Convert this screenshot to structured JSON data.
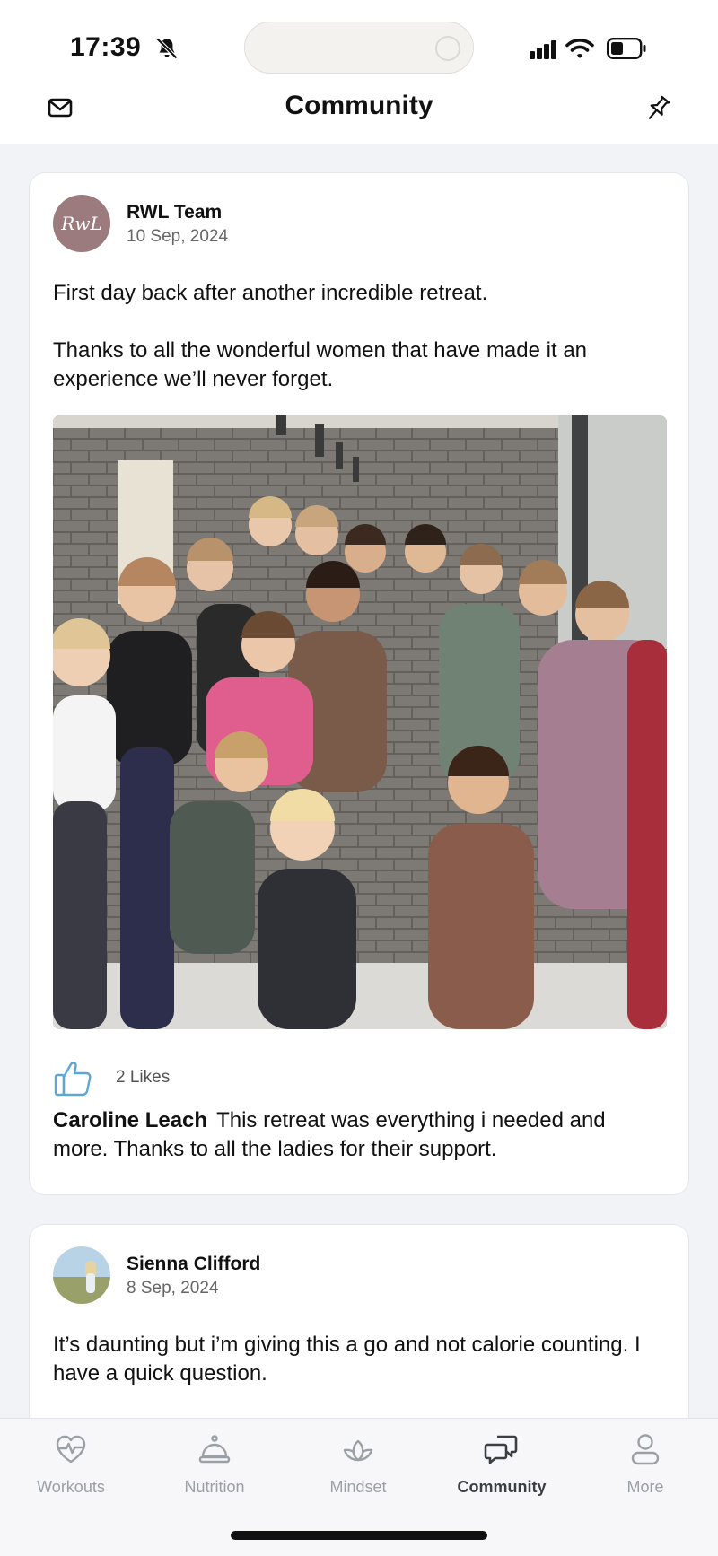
{
  "status_bar": {
    "time": "17:39",
    "icons": [
      "bell-slash-icon",
      "signal-icon",
      "wifi-icon",
      "battery-icon"
    ]
  },
  "header": {
    "title": "Community",
    "left_icon": "mail-icon",
    "right_icon": "pin-icon"
  },
  "posts": [
    {
      "author": "RWL Team",
      "avatar_text": "RwL",
      "date": "10 Sep, 2024",
      "paragraphs": [
        "First day back after another incredible retreat.",
        "Thanks to all the wonderful women that have made it an experience we’ll never forget."
      ],
      "likes": "2 Likes",
      "comment": {
        "author": "Caroline Leach",
        "text": "This retreat was everything i needed and more. Thanks to all the ladies for their support."
      }
    },
    {
      "author": "Sienna Clifford",
      "date": "8 Sep, 2024",
      "paragraphs": [
        "It’s daunting but i’m giving this a go and not calorie counting. I have a quick question."
      ]
    }
  ],
  "tabs": [
    {
      "label": "Workouts",
      "icon": "heart-pulse-icon"
    },
    {
      "label": "Nutrition",
      "icon": "bell-cloche-icon"
    },
    {
      "label": "Mindset",
      "icon": "lotus-icon"
    },
    {
      "label": "Community",
      "icon": "chat-bubbles-icon",
      "active": true
    },
    {
      "label": "More",
      "icon": "person-icon"
    }
  ],
  "colors": {
    "accent": "#5aa7d8",
    "tab_inactive": "#9aa0a6",
    "tab_active": "#3a3f45",
    "avatar_rwl": "#9b7b7d"
  }
}
